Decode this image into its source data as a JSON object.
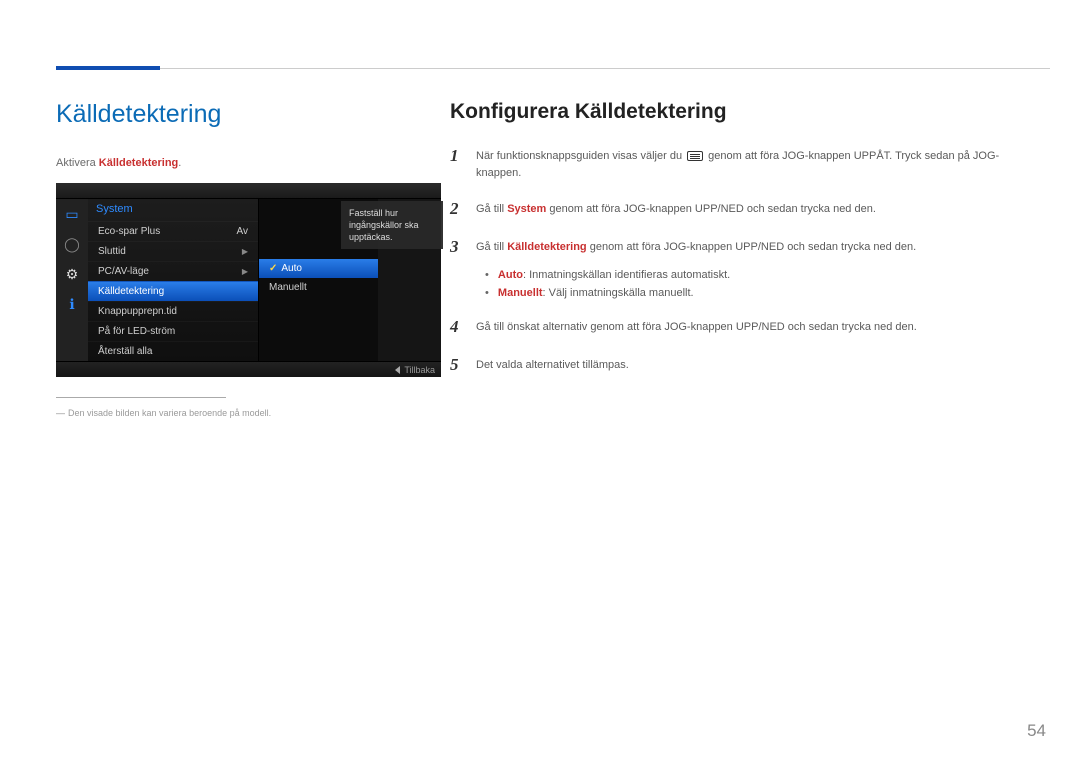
{
  "page_number": "54",
  "left": {
    "title": "Källdetektering",
    "sub_pre": "Aktivera ",
    "sub_strong": "Källdetektering",
    "sub_post": ".",
    "footnote": "Den visade bilden kan variera beroende på modell."
  },
  "osd": {
    "header": "System",
    "items": [
      {
        "label": "Eco-spar Plus",
        "value": "Av"
      },
      {
        "label": "Sluttid",
        "value": ""
      },
      {
        "label": "PC/AV-läge",
        "value": ""
      },
      {
        "label": "Källdetektering",
        "value": ""
      },
      {
        "label": "Knappupprepn.tid",
        "value": ""
      },
      {
        "label": "På för LED-ström",
        "value": ""
      },
      {
        "label": "Återställ alla",
        "value": ""
      }
    ],
    "submenu": [
      "Auto",
      "Manuellt"
    ],
    "tooltip": "Fastställ hur ingångskällor ska upptäckas.",
    "back": "Tillbaka"
  },
  "right": {
    "title": "Konfigurera Källdetektering",
    "step1": {
      "pre": "När funktionsknappsguiden visas väljer du ",
      "post": " genom att föra JOG-knappen UPPÅT. Tryck sedan på JOG-knappen."
    },
    "step2": {
      "pre": "Gå till ",
      "strong": "System",
      "post": " genom att föra JOG-knappen UPP/NED och sedan trycka ned den."
    },
    "step3": {
      "pre": "Gå till ",
      "strong": "Källdetektering",
      "post": " genom att föra JOG-knappen UPP/NED och sedan trycka ned den."
    },
    "bullets": {
      "auto_label": "Auto",
      "auto_text": ": Inmatningskällan identifieras automatiskt.",
      "man_label": "Manuellt",
      "man_text": ": Välj inmatningskälla manuellt."
    },
    "step4": "Gå till önskat alternativ genom att föra JOG-knappen UPP/NED och sedan trycka ned den.",
    "step5": "Det valda alternativet tillämpas."
  }
}
